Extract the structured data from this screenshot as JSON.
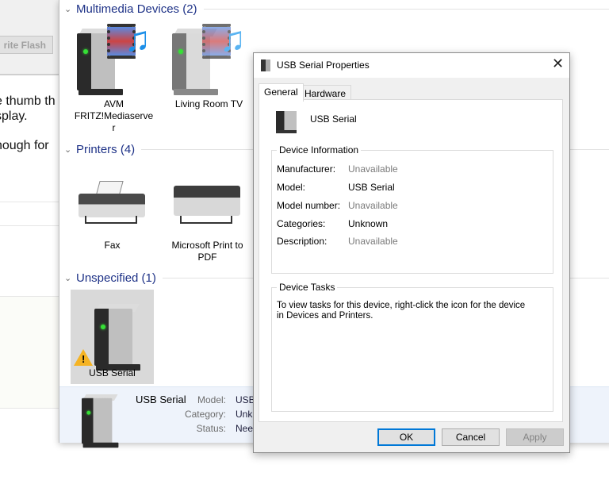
{
  "background_app": {
    "button_label": "rite Flash",
    "text_lines": [
      "e thumb th",
      "splay.",
      "hough for"
    ]
  },
  "explorer": {
    "groups": [
      {
        "title": "Multimedia Devices (2)",
        "items": [
          {
            "label": "AVM FRITZ!Mediaserve r",
            "icon": "media-server-icon"
          },
          {
            "label": "Living Room TV",
            "icon": "media-server-icon"
          }
        ]
      },
      {
        "title": "Printers (4)",
        "items": [
          {
            "label": "Fax",
            "icon": "fax-icon"
          },
          {
            "label": "Microsoft Print to PDF",
            "icon": "printer-icon"
          }
        ]
      },
      {
        "title": "Unspecified (1)",
        "items": [
          {
            "label": "USB Serial",
            "icon": "device-warning-icon",
            "selected": true
          }
        ]
      }
    ],
    "details": {
      "name": "USB Serial",
      "fields": [
        {
          "label": "Model:",
          "value": "USB"
        },
        {
          "label": "Category:",
          "value": "Unkn"
        },
        {
          "label": "Status:",
          "value": "Need"
        }
      ]
    }
  },
  "dialog": {
    "title": "USB Serial Properties",
    "tabs": [
      {
        "label": "General",
        "active": true
      },
      {
        "label": "Hardware",
        "active": false
      }
    ],
    "device_name": "USB Serial",
    "device_info": {
      "title": "Device Information",
      "rows": [
        {
          "label": "Manufacturer:",
          "value": "Unavailable",
          "muted": true
        },
        {
          "label": "Model:",
          "value": "USB Serial",
          "muted": false
        },
        {
          "label": "Model number:",
          "value": "Unavailable",
          "muted": true
        },
        {
          "label": "Categories:",
          "value": "Unknown",
          "muted": false
        },
        {
          "label": "Description:",
          "value": "Unavailable",
          "muted": true
        }
      ]
    },
    "device_tasks": {
      "title": "Device Tasks",
      "text": "To view tasks for this device, right-click the icon for the device in Devices and Printers."
    },
    "buttons": {
      "ok": "OK",
      "cancel": "Cancel",
      "apply": "Apply"
    },
    "colors": {
      "default_button_border": "#0078d7",
      "group_header": "#1e3287"
    }
  }
}
